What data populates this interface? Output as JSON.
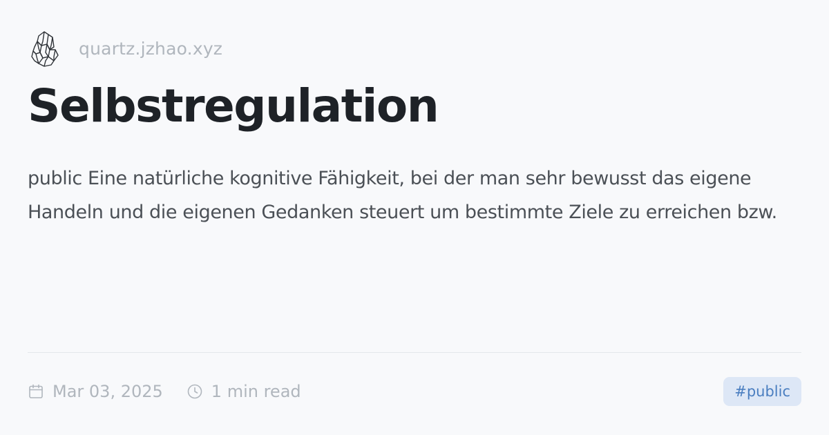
{
  "site": {
    "name": "quartz.jzhao.xyz",
    "logo_icon": "crystal-quartz-logo"
  },
  "page": {
    "title": "Selbstregulation",
    "description": "public Eine natürliche kognitive Fähigkeit, bei der man sehr bewusst das eigene Handeln und die eigenen Gedanken steuert um bestimmte Ziele zu erreichen bzw."
  },
  "footer": {
    "date": "Mar 03, 2025",
    "date_icon": "calendar-icon",
    "reading_time": "1 min read",
    "reading_time_icon": "clock-icon",
    "tag": "#public"
  },
  "colors": {
    "background": "#f8f9fb",
    "title": "#1e2227",
    "body_text": "#4b5056",
    "muted_text": "#b0b6bd",
    "tag_background": "#dde7f6",
    "tag_text": "#4a7ec0"
  }
}
